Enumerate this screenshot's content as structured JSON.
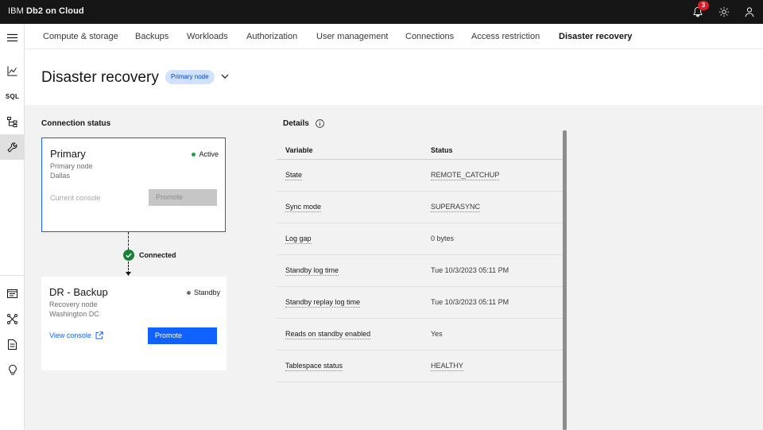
{
  "header": {
    "brand_prefix": "IBM ",
    "brand_name": "Db2 on Cloud",
    "notification_count": "3"
  },
  "rail": {
    "sql_label": "SQL"
  },
  "tabs": [
    {
      "label": "Compute & storage"
    },
    {
      "label": "Backups"
    },
    {
      "label": "Workloads"
    },
    {
      "label": "Authorization"
    },
    {
      "label": "User management"
    },
    {
      "label": "Connections"
    },
    {
      "label": "Access restriction"
    },
    {
      "label": "Disaster recovery"
    }
  ],
  "page": {
    "title": "Disaster recovery",
    "tag": "Primary node"
  },
  "connection_status": {
    "title": "Connection status",
    "primary": {
      "title": "Primary",
      "subtitle": "Primary node",
      "location": "Dallas",
      "status": "Active",
      "status_color": "#24a148",
      "console_label": "Current console",
      "button": "Promote"
    },
    "connector_label": "Connected",
    "backup": {
      "title": "DR - Backup",
      "subtitle": "Recovery node",
      "location": "Washington DC",
      "status": "Standby",
      "status_color": "#6f6f6f",
      "link": "View console",
      "button": "Promote"
    }
  },
  "details": {
    "title": "Details",
    "columns": {
      "variable": "Variable",
      "status": "Status"
    },
    "rows": [
      {
        "variable": "State",
        "status": "REMOTE_CATCHUP"
      },
      {
        "variable": "Sync mode",
        "status": "SUPERASYNC"
      },
      {
        "variable": "Log gap",
        "status": "0 bytes"
      },
      {
        "variable": "Standby log time",
        "status": "Tue 10/3/2023 05:11 PM"
      },
      {
        "variable": "Standby replay log time",
        "status": "Tue 10/3/2023 05:11 PM"
      },
      {
        "variable": "Reads on standby enabled",
        "status": "Yes"
      },
      {
        "variable": "Tablespace status",
        "status": "HEALTHY"
      }
    ]
  },
  "colors": {
    "accent": "#0f62fe",
    "header_bg": "#161616",
    "tag_bg": "#d0e2ff",
    "badge": "#da1e28"
  }
}
